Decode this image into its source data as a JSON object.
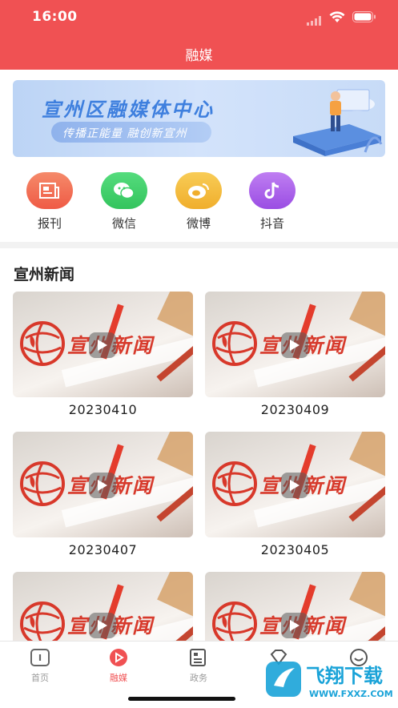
{
  "status_bar": {
    "time": "16:00"
  },
  "header": {
    "title": "融媒"
  },
  "banner": {
    "title": "宣州区融媒体中心",
    "subtitle": "传播正能量  融创新宣州"
  },
  "quick_links": [
    {
      "label": "报刊",
      "icon": "newspaper-icon",
      "color": "#f26b4f"
    },
    {
      "label": "微信",
      "icon": "wechat-icon",
      "color": "#3fcf6a"
    },
    {
      "label": "微博",
      "icon": "weibo-icon",
      "color": "#f2b93b"
    },
    {
      "label": "抖音",
      "icon": "douyin-icon",
      "color": "#a45be8"
    }
  ],
  "section": {
    "title": "宣州新闻"
  },
  "videos": [
    {
      "logo_text": "宣州新闻",
      "date": "20230410"
    },
    {
      "logo_text": "宣州新闻",
      "date": "20230409"
    },
    {
      "logo_text": "宣州新闻",
      "date": "20230407"
    },
    {
      "logo_text": "宣州新闻",
      "date": "20230405"
    },
    {
      "logo_text": "宣州新闻",
      "date": ""
    },
    {
      "logo_text": "宣州新闻",
      "date": ""
    }
  ],
  "tabbar": {
    "items": [
      {
        "label": "首页",
        "icon": "home-icon"
      },
      {
        "label": "融媒",
        "icon": "play-circle-icon",
        "active": true
      },
      {
        "label": "政务",
        "icon": "document-icon"
      },
      {
        "label": "",
        "icon": "gem-icon"
      },
      {
        "label": "",
        "icon": "smile-icon"
      }
    ]
  },
  "watermark": {
    "text": "飞翔下载",
    "url_text": "WWW.FXXZ.COM"
  },
  "colors": {
    "brand": "#f05153",
    "banner_text": "#3e7fde",
    "tab_inactive": "#9a9a9a"
  }
}
